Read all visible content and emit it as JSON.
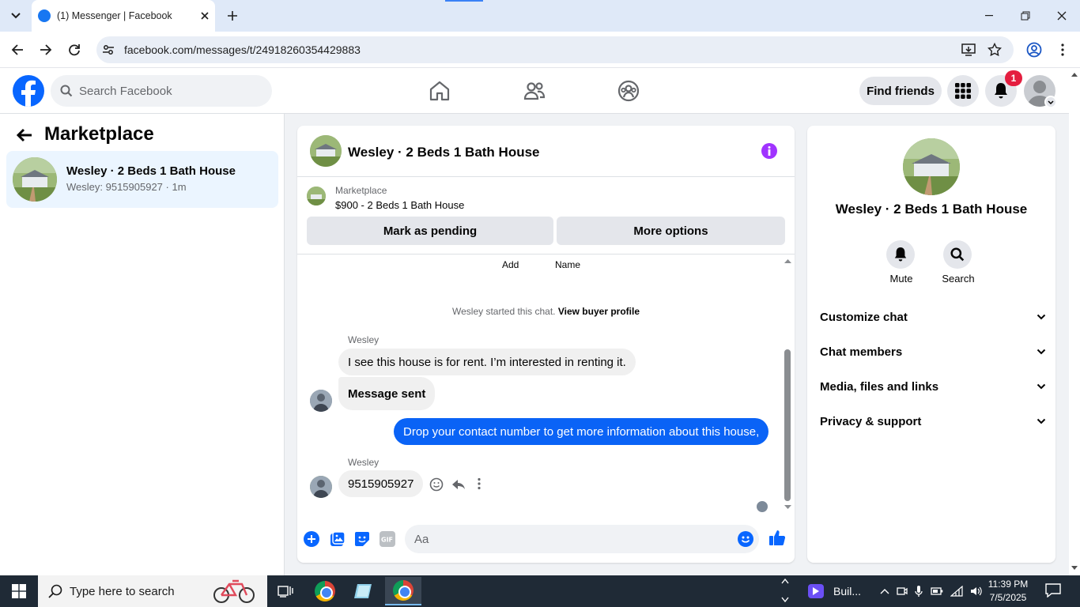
{
  "browser": {
    "tab_title": "(1) Messenger | Facebook",
    "url": "facebook.com/messages/t/24918260354429883"
  },
  "fb_header": {
    "search_placeholder": "Search Facebook",
    "find_friends_label": "Find friends",
    "notification_count": "1"
  },
  "sidebar": {
    "title": "Marketplace",
    "conversation": {
      "name": "Wesley · 2 Beds 1 Bath House",
      "preview": "Wesley: 9515905927 · 1m"
    }
  },
  "chat": {
    "header_title": "Wesley · 2 Beds 1 Bath House",
    "listing": {
      "source": "Marketplace",
      "price_title": "$900 - 2 Beds 1 Bath House"
    },
    "mark_pending_label": "Mark as pending",
    "more_options_label": "More options",
    "partial_actions": [
      "Add",
      "Name"
    ],
    "system_message": "Wesley started this chat.",
    "system_link": "View buyer profile",
    "messages": [
      {
        "sender": "Wesley",
        "text": "I see this house is for rent. I’m interested in renting it."
      },
      {
        "sender": "",
        "text": "Message sent"
      },
      {
        "sender": "me",
        "text": "Drop your contact number to get more information about this house,"
      },
      {
        "sender": "Wesley",
        "text": "9515905927"
      }
    ],
    "composer_placeholder": "Aa"
  },
  "info_panel": {
    "title": "Wesley · 2 Beds 1 Bath House",
    "mute_label": "Mute",
    "search_label": "Search",
    "sections": [
      "Customize chat",
      "Chat members",
      "Media, files and links",
      "Privacy & support"
    ]
  },
  "taskbar": {
    "search_placeholder": "Type here to search",
    "app_label": "Buil...",
    "time": "11:39 PM",
    "date": "7/5/2025"
  },
  "colors": {
    "fb_blue": "#0866ff",
    "bubble_blue": "#0a63f6",
    "info_purple": "#a033ff",
    "badge_red": "#e41e3f"
  }
}
